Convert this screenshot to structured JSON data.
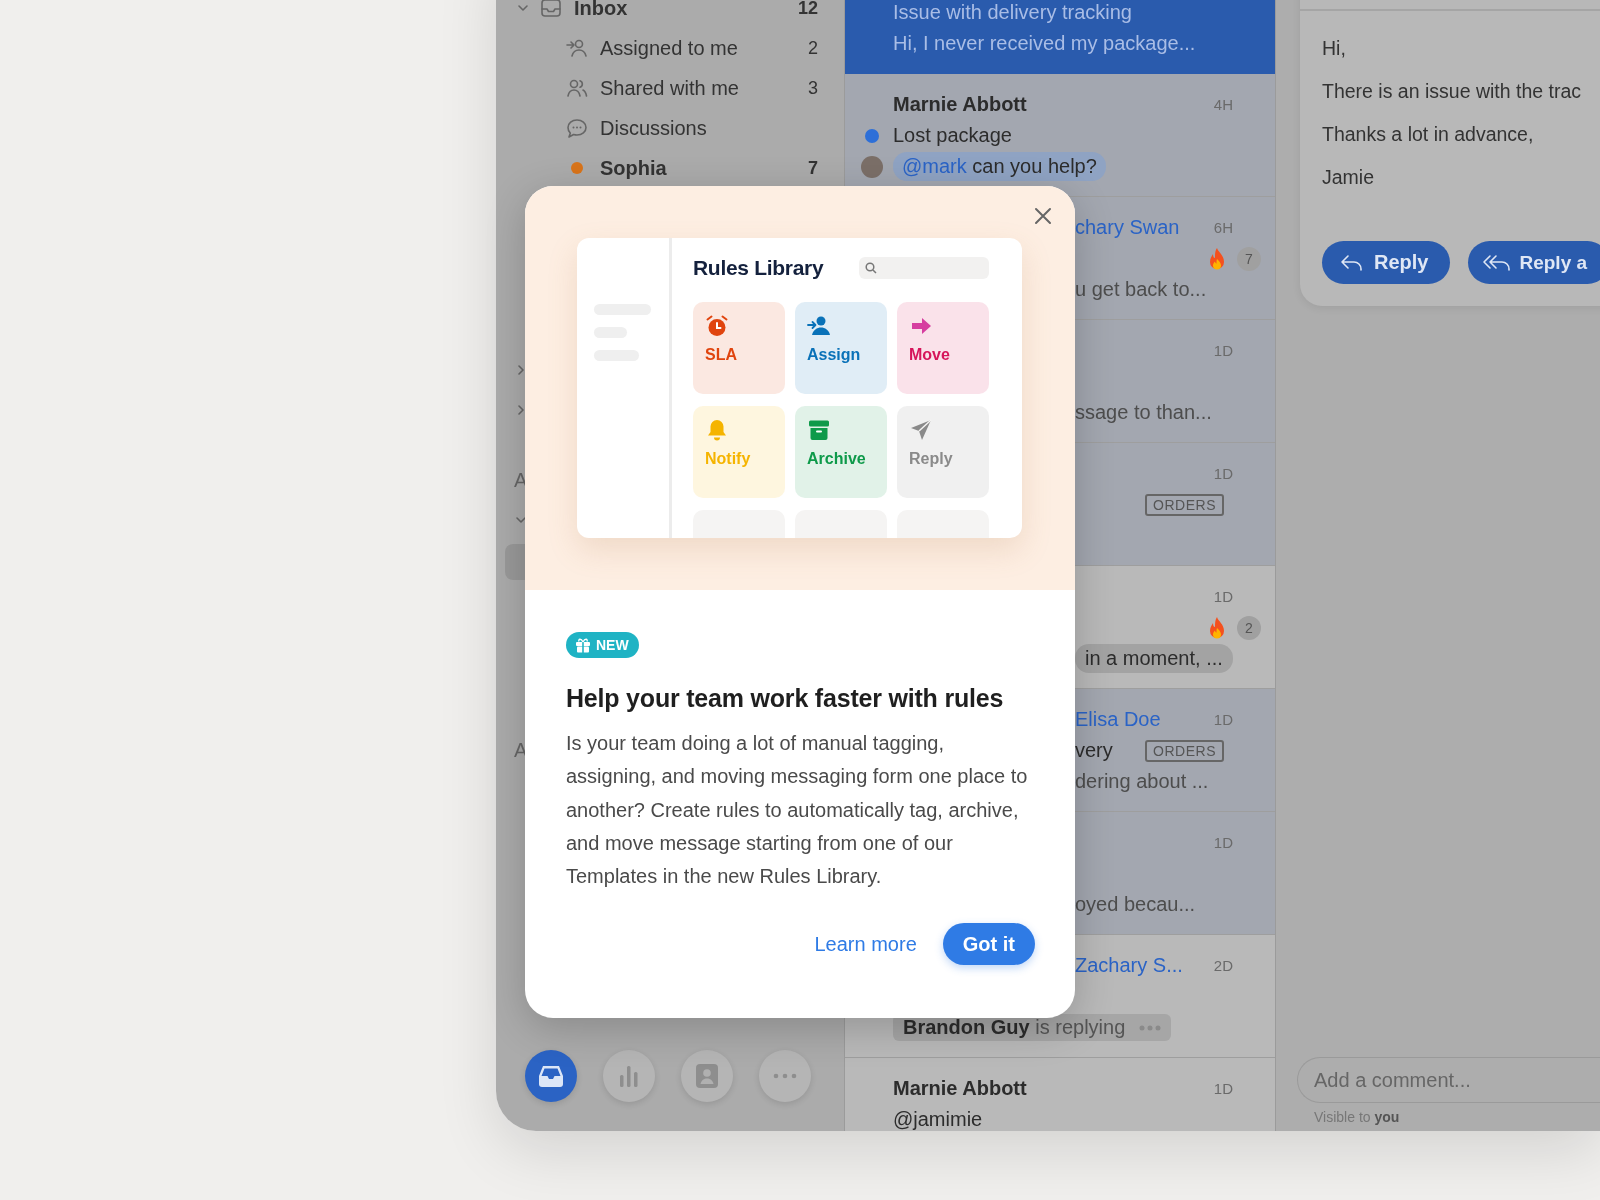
{
  "sidebar": {
    "items": [
      {
        "kind": "folder",
        "label": "Inbox",
        "count": "12"
      },
      {
        "kind": "assigned",
        "label": "Assigned to me",
        "count": "2"
      },
      {
        "kind": "shared",
        "label": "Shared with me",
        "count": "3"
      },
      {
        "kind": "discussions",
        "label": "Discussions"
      },
      {
        "kind": "teammate",
        "label": "Sophia",
        "count": "7",
        "color": "#d9741a"
      }
    ],
    "fragments": [
      {
        "kind": "chevron",
        "expanded": false
      },
      {
        "kind": "chevron",
        "expanded": false
      },
      {
        "kind": "heading",
        "text": "A"
      },
      {
        "kind": "chevron",
        "expanded": true
      },
      {
        "kind": "highlight"
      },
      {
        "kind": "heading",
        "text": "A"
      }
    ],
    "nav": [
      {
        "kind": "inbox",
        "selected": true
      },
      {
        "kind": "analytics",
        "selected": false
      },
      {
        "kind": "contacts",
        "selected": false
      },
      {
        "kind": "more",
        "selected": false
      }
    ]
  },
  "list": {
    "rows": [
      {
        "selected": true,
        "lines": [
          {
            "kind": "subject",
            "text": "Issue with delivery tracking"
          },
          {
            "kind": "preview",
            "text": "Hi, I never received my package..."
          }
        ]
      },
      {
        "selected": false,
        "unread": true,
        "sender": {
          "kind": "contact",
          "name": "Marnie Abbott"
        },
        "time": "4H",
        "lines": [
          {
            "kind": "dot",
            "text": "Lost package",
            "color": "#2d6fd8"
          },
          {
            "kind": "comment",
            "mention": "@mark",
            "text": "can you help?"
          }
        ]
      },
      {
        "selected": false,
        "unread": true,
        "sender": {
          "kind": "assignee",
          "name": "chary Swan"
        },
        "time": "6H",
        "lines": [
          {
            "kind": "hot",
            "count": "7"
          },
          {
            "kind": "preview",
            "text": "u get back to..."
          }
        ]
      },
      {
        "selected": false,
        "unread": true,
        "time": "1D",
        "lines": [
          {
            "kind": "preview",
            "text": "ssage to than..."
          }
        ]
      },
      {
        "selected": false,
        "unread": true,
        "time": "1D",
        "lines": [
          {
            "kind": "tag",
            "text": "ORDERS"
          }
        ]
      },
      {
        "selected": false,
        "unread": false,
        "time": "1D",
        "lines": [
          {
            "kind": "hot",
            "count": "2"
          },
          {
            "kind": "pill",
            "text": "in a moment, ..."
          }
        ]
      },
      {
        "selected": false,
        "unread": true,
        "sender": {
          "kind": "assignee",
          "name": "Elisa Doe"
        },
        "time": "1D",
        "lines": [
          {
            "kind": "subject",
            "text": "very",
            "tag": "ORDERS"
          },
          {
            "kind": "preview",
            "text": "dering about ..."
          }
        ]
      },
      {
        "selected": false,
        "unread": true,
        "time": "1D",
        "lines": [
          {
            "kind": "preview",
            "text": "oyed becau..."
          }
        ]
      },
      {
        "selected": false,
        "unread": false,
        "sender": {
          "kind": "assignee",
          "name": "Zachary S..."
        },
        "time": "2D",
        "lines": [
          {
            "kind": "typing",
            "text": "**Brandon Guy** is replying"
          }
        ]
      },
      {
        "selected": false,
        "unread": false,
        "sender": {
          "kind": "contact",
          "name": "Marnie Abbott"
        },
        "time": "1D",
        "lines": [
          {
            "kind": "subject",
            "text": "@jamimie"
          }
        ]
      }
    ]
  },
  "detail": {
    "message": [
      "Hi,",
      "There is an issue with the trac",
      "Thanks a lot in advance,",
      "Jamie"
    ],
    "buttons": [
      {
        "kind": "reply",
        "label": "Reply"
      },
      {
        "kind": "reply-all",
        "label": "Reply a"
      }
    ],
    "comment": {
      "placeholder": "Add a comment...",
      "note": "Visible to **you**"
    }
  },
  "modal": {
    "illustration": {
      "title": "Rules Library",
      "tiles": [
        {
          "kind": "sla",
          "label": "SLA",
          "color": "#e0440e"
        },
        {
          "kind": "assign",
          "label": "Assign",
          "color": "#0a72b8"
        },
        {
          "kind": "move",
          "label": "Move",
          "color": "#d6155b"
        },
        {
          "kind": "notify",
          "label": "Notify",
          "color": "#f5b400"
        },
        {
          "kind": "archive",
          "label": "Archive",
          "color": "#0e9a4a"
        },
        {
          "kind": "reply",
          "label": "Reply",
          "color": "#8a8a8a"
        }
      ]
    },
    "badge": "NEW",
    "title": "Help your team work faster with rules",
    "body": "Is your team doing a lot of manual tagging, assigning, and moving messaging form one place to another? Create rules to automatically tag, archive, and move message starting from one of our Templates in the new Rules Library.",
    "actions": [
      {
        "kind": "link",
        "label": "Learn more"
      },
      {
        "kind": "primary",
        "label": "Got it"
      }
    ]
  }
}
